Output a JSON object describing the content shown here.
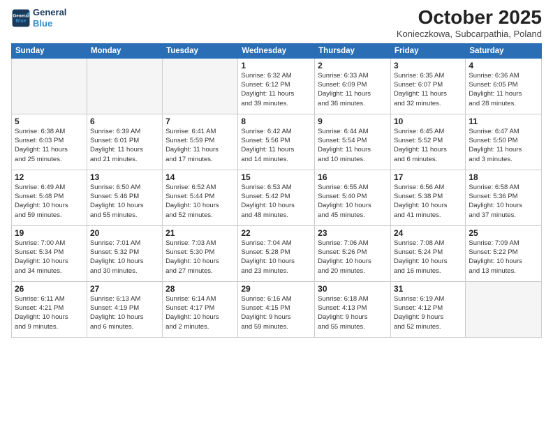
{
  "header": {
    "logo_line1": "General",
    "logo_line2": "Blue",
    "month": "October 2025",
    "location": "Konieczkowa, Subcarpathia, Poland"
  },
  "weekdays": [
    "Sunday",
    "Monday",
    "Tuesday",
    "Wednesday",
    "Thursday",
    "Friday",
    "Saturday"
  ],
  "weeks": [
    [
      {
        "day": "",
        "info": ""
      },
      {
        "day": "",
        "info": ""
      },
      {
        "day": "",
        "info": ""
      },
      {
        "day": "1",
        "info": "Sunrise: 6:32 AM\nSunset: 6:12 PM\nDaylight: 11 hours\nand 39 minutes."
      },
      {
        "day": "2",
        "info": "Sunrise: 6:33 AM\nSunset: 6:09 PM\nDaylight: 11 hours\nand 36 minutes."
      },
      {
        "day": "3",
        "info": "Sunrise: 6:35 AM\nSunset: 6:07 PM\nDaylight: 11 hours\nand 32 minutes."
      },
      {
        "day": "4",
        "info": "Sunrise: 6:36 AM\nSunset: 6:05 PM\nDaylight: 11 hours\nand 28 minutes."
      }
    ],
    [
      {
        "day": "5",
        "info": "Sunrise: 6:38 AM\nSunset: 6:03 PM\nDaylight: 11 hours\nand 25 minutes."
      },
      {
        "day": "6",
        "info": "Sunrise: 6:39 AM\nSunset: 6:01 PM\nDaylight: 11 hours\nand 21 minutes."
      },
      {
        "day": "7",
        "info": "Sunrise: 6:41 AM\nSunset: 5:59 PM\nDaylight: 11 hours\nand 17 minutes."
      },
      {
        "day": "8",
        "info": "Sunrise: 6:42 AM\nSunset: 5:56 PM\nDaylight: 11 hours\nand 14 minutes."
      },
      {
        "day": "9",
        "info": "Sunrise: 6:44 AM\nSunset: 5:54 PM\nDaylight: 11 hours\nand 10 minutes."
      },
      {
        "day": "10",
        "info": "Sunrise: 6:45 AM\nSunset: 5:52 PM\nDaylight: 11 hours\nand 6 minutes."
      },
      {
        "day": "11",
        "info": "Sunrise: 6:47 AM\nSunset: 5:50 PM\nDaylight: 11 hours\nand 3 minutes."
      }
    ],
    [
      {
        "day": "12",
        "info": "Sunrise: 6:49 AM\nSunset: 5:48 PM\nDaylight: 10 hours\nand 59 minutes."
      },
      {
        "day": "13",
        "info": "Sunrise: 6:50 AM\nSunset: 5:46 PM\nDaylight: 10 hours\nand 55 minutes."
      },
      {
        "day": "14",
        "info": "Sunrise: 6:52 AM\nSunset: 5:44 PM\nDaylight: 10 hours\nand 52 minutes."
      },
      {
        "day": "15",
        "info": "Sunrise: 6:53 AM\nSunset: 5:42 PM\nDaylight: 10 hours\nand 48 minutes."
      },
      {
        "day": "16",
        "info": "Sunrise: 6:55 AM\nSunset: 5:40 PM\nDaylight: 10 hours\nand 45 minutes."
      },
      {
        "day": "17",
        "info": "Sunrise: 6:56 AM\nSunset: 5:38 PM\nDaylight: 10 hours\nand 41 minutes."
      },
      {
        "day": "18",
        "info": "Sunrise: 6:58 AM\nSunset: 5:36 PM\nDaylight: 10 hours\nand 37 minutes."
      }
    ],
    [
      {
        "day": "19",
        "info": "Sunrise: 7:00 AM\nSunset: 5:34 PM\nDaylight: 10 hours\nand 34 minutes."
      },
      {
        "day": "20",
        "info": "Sunrise: 7:01 AM\nSunset: 5:32 PM\nDaylight: 10 hours\nand 30 minutes."
      },
      {
        "day": "21",
        "info": "Sunrise: 7:03 AM\nSunset: 5:30 PM\nDaylight: 10 hours\nand 27 minutes."
      },
      {
        "day": "22",
        "info": "Sunrise: 7:04 AM\nSunset: 5:28 PM\nDaylight: 10 hours\nand 23 minutes."
      },
      {
        "day": "23",
        "info": "Sunrise: 7:06 AM\nSunset: 5:26 PM\nDaylight: 10 hours\nand 20 minutes."
      },
      {
        "day": "24",
        "info": "Sunrise: 7:08 AM\nSunset: 5:24 PM\nDaylight: 10 hours\nand 16 minutes."
      },
      {
        "day": "25",
        "info": "Sunrise: 7:09 AM\nSunset: 5:22 PM\nDaylight: 10 hours\nand 13 minutes."
      }
    ],
    [
      {
        "day": "26",
        "info": "Sunrise: 6:11 AM\nSunset: 4:21 PM\nDaylight: 10 hours\nand 9 minutes."
      },
      {
        "day": "27",
        "info": "Sunrise: 6:13 AM\nSunset: 4:19 PM\nDaylight: 10 hours\nand 6 minutes."
      },
      {
        "day": "28",
        "info": "Sunrise: 6:14 AM\nSunset: 4:17 PM\nDaylight: 10 hours\nand 2 minutes."
      },
      {
        "day": "29",
        "info": "Sunrise: 6:16 AM\nSunset: 4:15 PM\nDaylight: 9 hours\nand 59 minutes."
      },
      {
        "day": "30",
        "info": "Sunrise: 6:18 AM\nSunset: 4:13 PM\nDaylight: 9 hours\nand 55 minutes."
      },
      {
        "day": "31",
        "info": "Sunrise: 6:19 AM\nSunset: 4:12 PM\nDaylight: 9 hours\nand 52 minutes."
      },
      {
        "day": "",
        "info": ""
      }
    ]
  ]
}
